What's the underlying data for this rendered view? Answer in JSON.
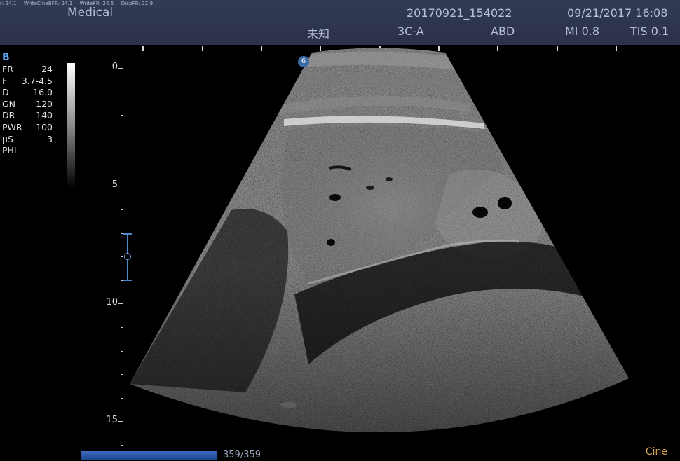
{
  "header": {
    "fps": [
      "r: 24.1",
      "WriteCineBFR: 24.1",
      "WriteFR: 24.5",
      "DispFR: 22.9"
    ],
    "institution": "Medical",
    "exam_id": "20170921_154022",
    "datetime": "09/21/2017 16:08",
    "patient": "未知",
    "probe": "3C-A",
    "preset": "ABD",
    "mi": "MI 0.8",
    "tis": "TIS 0.1"
  },
  "params": {
    "mode": "B",
    "rows": [
      {
        "label": "FR",
        "value": "24"
      },
      {
        "label": "F",
        "value": "3.7-4.5"
      },
      {
        "label": "D",
        "value": "16.0"
      },
      {
        "label": "GN",
        "value": "120"
      },
      {
        "label": "DR",
        "value": "140"
      },
      {
        "label": "PWR",
        "value": "100"
      },
      {
        "label": "μS",
        "value": "3"
      },
      {
        "label": "PHI",
        "value": ""
      }
    ]
  },
  "depth_scale": {
    "labels": [
      "0",
      "5",
      "10",
      "15"
    ],
    "max_cm": 16
  },
  "orientation_marker": "6",
  "cine": {
    "frame": "359/359",
    "label": "Cine",
    "progress": 1.0
  },
  "colors": {
    "header_bg": "#2f3750",
    "accent": "#3d6cc2",
    "cine_label": "#d9a050",
    "focus": "#4a8ad0"
  }
}
